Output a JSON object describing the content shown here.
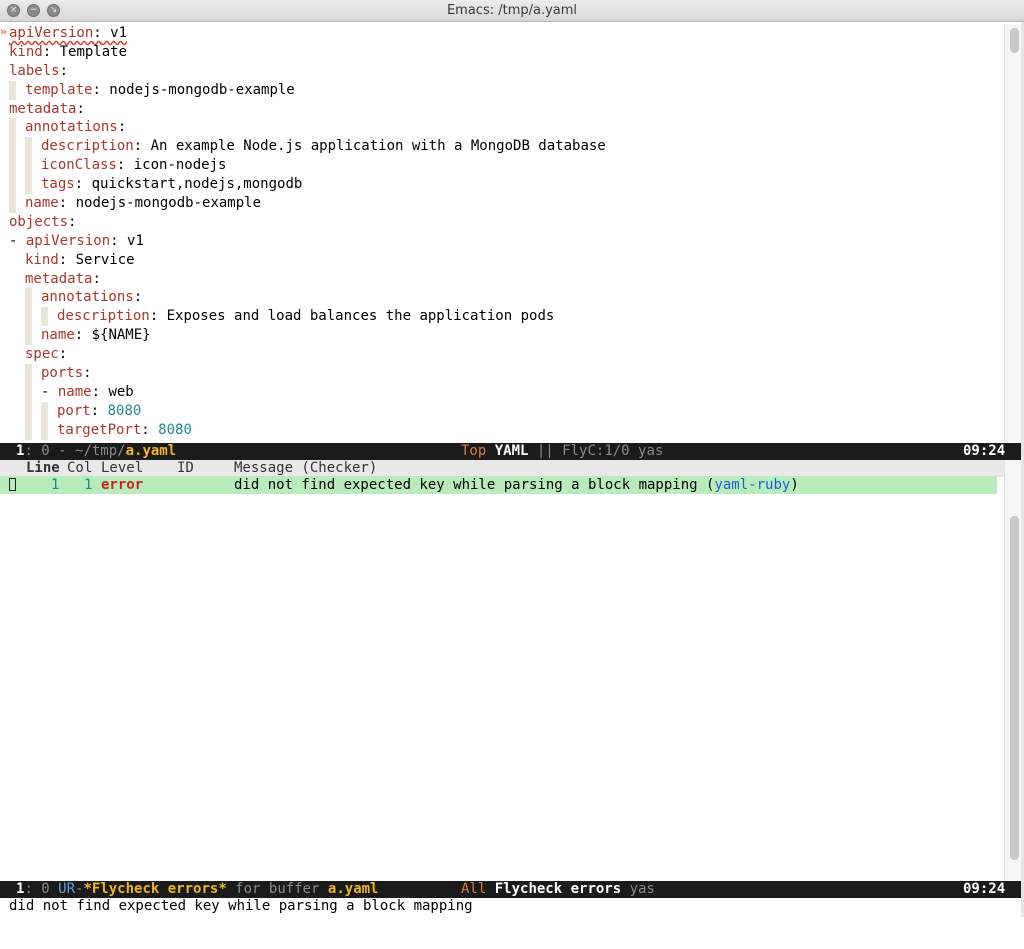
{
  "window": {
    "title": "Emacs: /tmp/a.yaml",
    "close_glyph": "×",
    "min_glyph": "−",
    "max_glyph": "↘"
  },
  "editor": {
    "fringe_marker": "»",
    "lines": {
      "l1": {
        "key": "apiVersion",
        "sep": ":",
        "val": " v1"
      },
      "l2": {
        "key": "kind",
        "sep": ":",
        "val": " Template"
      },
      "l3": {
        "key": "labels",
        "sep": ":"
      },
      "l4": {
        "key": "template",
        "sep": ":",
        "val": " nodejs-mongodb-example"
      },
      "l5": {
        "key": "metadata",
        "sep": ":"
      },
      "l6": {
        "key": "annotations",
        "sep": ":"
      },
      "l7": {
        "key": "description",
        "sep": ":",
        "val": " An example Node.js application with a MongoDB database"
      },
      "l8": {
        "key": "iconClass",
        "sep": ":",
        "val": " icon-nodejs"
      },
      "l9": {
        "key": "tags",
        "sep": ":",
        "val": " quickstart,nodejs,mongodb"
      },
      "l10": {
        "key": "name",
        "sep": ":",
        "val": " nodejs-mongodb-example"
      },
      "l11": {
        "key": "objects",
        "sep": ":"
      },
      "l12": {
        "dash": "- ",
        "key": "apiVersion",
        "sep": ":",
        "val": " v1"
      },
      "l13": {
        "key": "kind",
        "sep": ":",
        "val": " Service"
      },
      "l14": {
        "key": "metadata",
        "sep": ":"
      },
      "l15": {
        "key": "annotations",
        "sep": ":"
      },
      "l16": {
        "key": "description",
        "sep": ":",
        "val": " Exposes and load balances the application pods"
      },
      "l17": {
        "key": "name",
        "sep": ":",
        "val": " ${NAME}"
      },
      "l18": {
        "key": "spec",
        "sep": ":"
      },
      "l19": {
        "key": "ports",
        "sep": ":"
      },
      "l20": {
        "dash": "- ",
        "key": "name",
        "sep": ":",
        "val": " web"
      },
      "l21": {
        "key": "port",
        "sep": ":",
        "val": " 8080"
      },
      "l22": {
        "key": "targetPort",
        "sep": ":",
        "val": " 8080"
      }
    }
  },
  "modeline_top": {
    "window_num": "1",
    "state": ": 0 - ",
    "path": "~/tmp/",
    "buffer": "a.yaml",
    "position": "Top",
    "mode": "YAML",
    "sep": " || ",
    "flycheck": "FlyC:1/0",
    "minor": "yas",
    "time": "09:24"
  },
  "errors_list": {
    "headers": {
      "line": "Line",
      "col": "Col",
      "level": "Level",
      "id": "ID",
      "message": "Message (Checker)"
    },
    "rows": [
      {
        "line": "1",
        "col": "1",
        "level": "error",
        "message": "did not find expected key while parsing a block mapping",
        "checker": "yaml-ruby"
      }
    ]
  },
  "modeline_bottom": {
    "window_num": "1",
    "state": ": 0 ",
    "ur": "UR",
    "dash": "-",
    "buffer": "*Flycheck errors*",
    "for_text": " for buffer ",
    "target": "a.yaml",
    "position": "All",
    "mode": "Flycheck errors",
    "minor": "yas",
    "time": "09:24"
  },
  "echo_area": {
    "message": "did not find expected key while parsing a block mapping"
  }
}
